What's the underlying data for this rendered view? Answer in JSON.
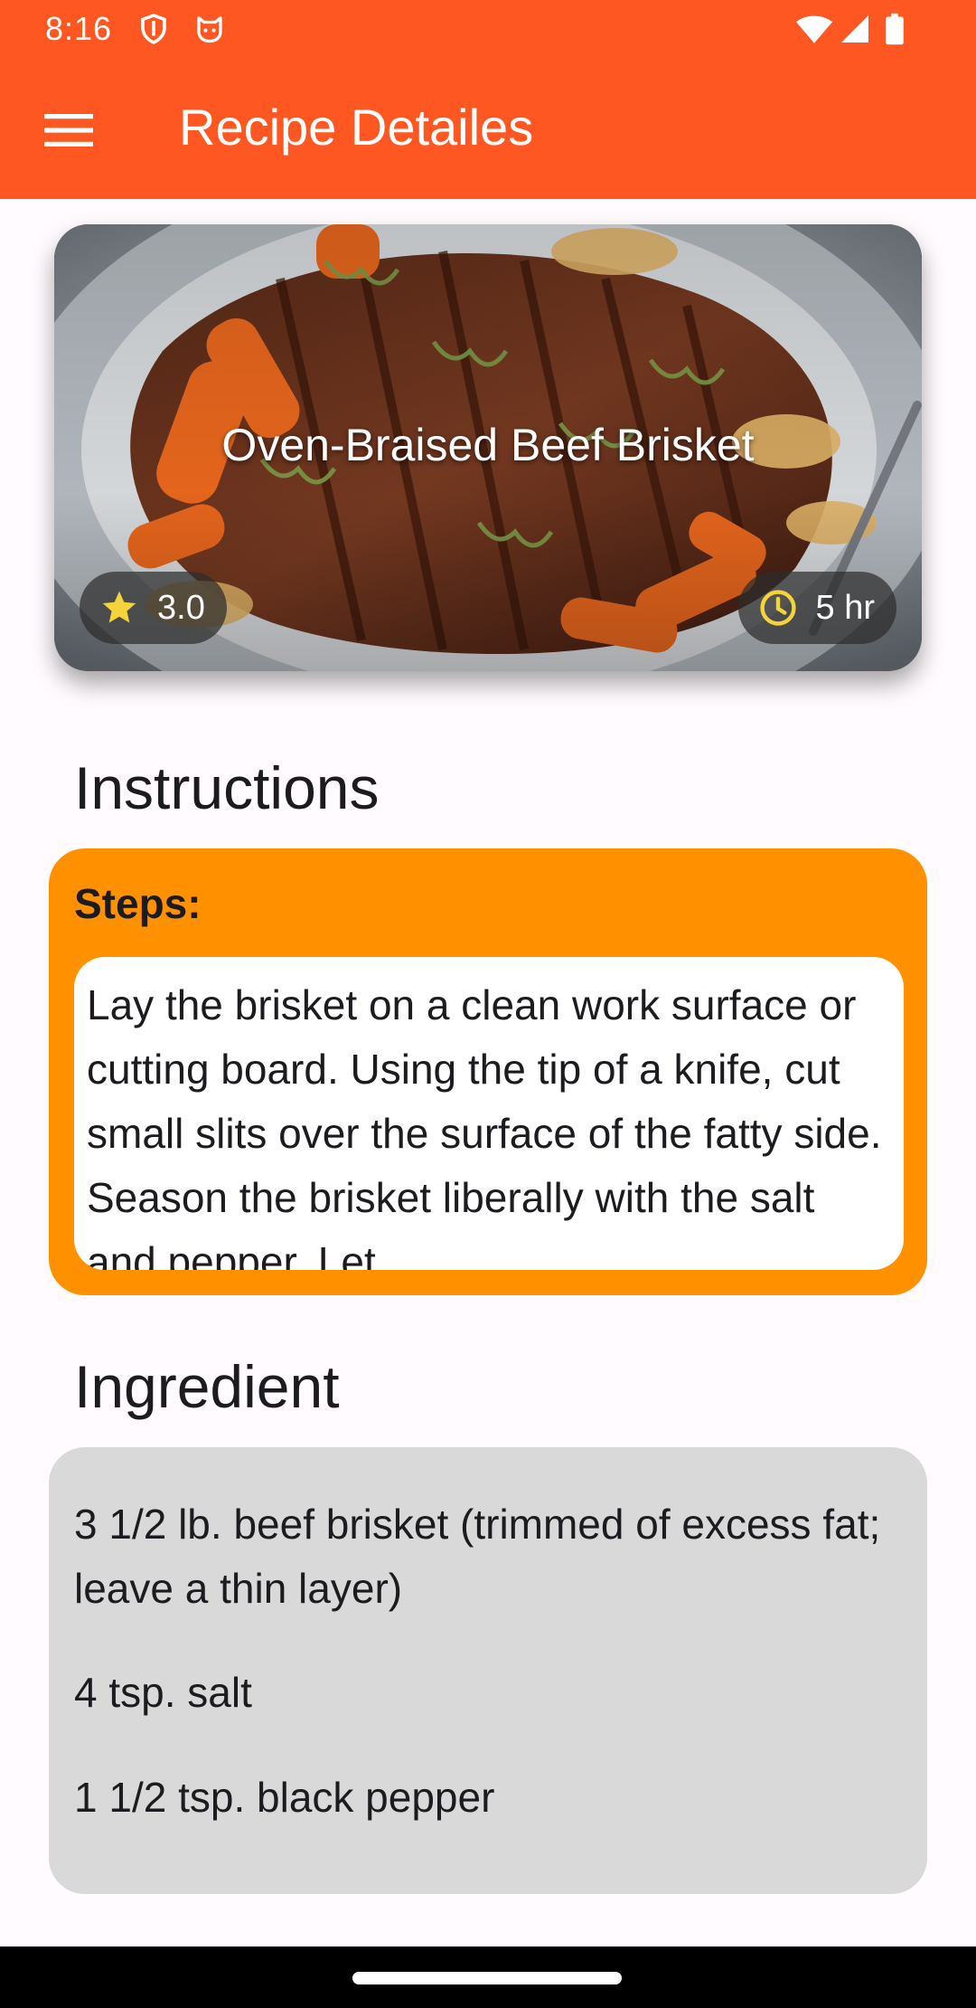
{
  "status_bar": {
    "time": "8:16",
    "icons": [
      "shield-icon",
      "cat-face-icon",
      "wifi-icon",
      "signal-icon",
      "battery-icon"
    ]
  },
  "app_bar": {
    "title": "Recipe Detailes",
    "menu_icon": "hamburger-menu-icon",
    "background": "#ff5722"
  },
  "recipe": {
    "name": "Oven-Braised Beef Brisket",
    "rating": "3.0",
    "time": "5 hr",
    "rating_icon": "star-icon",
    "time_icon": "clock-icon"
  },
  "instructions": {
    "heading": "Instructions",
    "steps_label": "Steps:",
    "steps_text": "Lay the brisket on a clean work surface or cutting board. Using the tip of a knife, cut small slits over the surface of the fatty side. Season the brisket liberally with the salt and pepper. Let",
    "card_color": "#ff9100"
  },
  "ingredients": {
    "heading": "Ingredient",
    "items": [
      "3 1/2 lb. beef brisket (trimmed of excess fat; leave a thin layer)",
      "4 tsp. salt",
      "1 1/2 tsp. black pepper"
    ],
    "card_color": "#d9d9d9"
  }
}
